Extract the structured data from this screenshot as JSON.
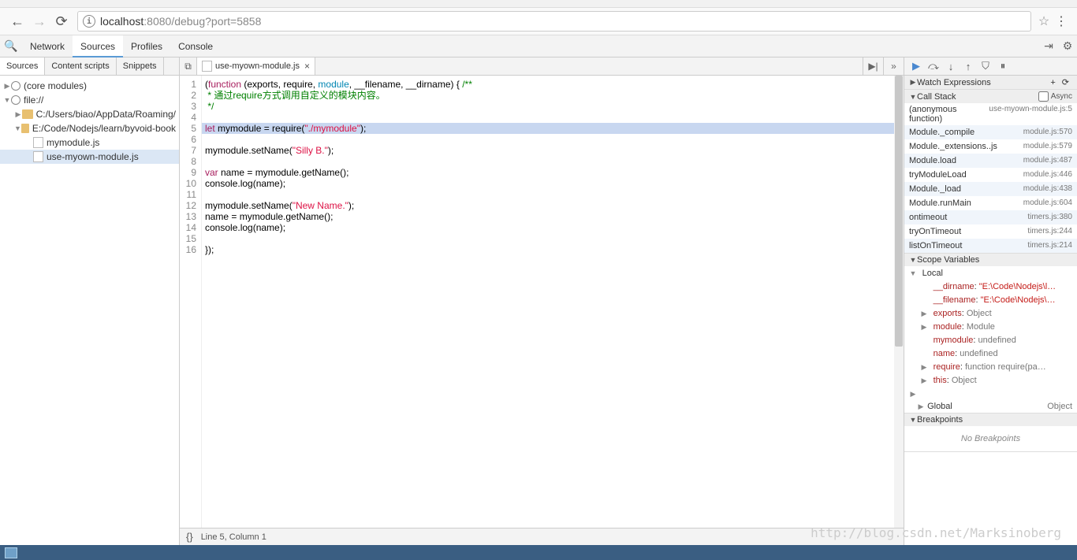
{
  "url": {
    "host": "localhost",
    "port": ":8080",
    "path": "/debug?port=5858"
  },
  "devtools_tabs": [
    "Network",
    "Sources",
    "Profiles",
    "Console"
  ],
  "devtools_active": 1,
  "left_tabs": [
    "Sources",
    "Content scripts",
    "Snippets"
  ],
  "left_active": 0,
  "file_tree": {
    "core": "(core modules)",
    "root": "file://",
    "folders": [
      "C:/Users/biao/AppData/Roaming/",
      "E:/Code/Nodejs/learn/byvoid-book"
    ],
    "files": [
      "mymodule.js",
      "use-myown-module.js"
    ]
  },
  "open_file": "use-myown-module.js",
  "status": "Line 5, Column 1",
  "code_lines": [
    {
      "n": 1,
      "segs": [
        [
          "(",
          "ident"
        ],
        [
          "function",
          "kw"
        ],
        [
          " (exports, require, ",
          "ident"
        ],
        [
          "module",
          "mod"
        ],
        [
          ", __filename, __dirname) { ",
          "ident"
        ],
        [
          "/**",
          "cmt"
        ]
      ]
    },
    {
      "n": 2,
      "segs": [
        [
          " * 通过require方式调用自定义的模块内容。",
          "cmt"
        ]
      ]
    },
    {
      "n": 3,
      "segs": [
        [
          " */",
          "cmt"
        ]
      ]
    },
    {
      "n": 4,
      "segs": []
    },
    {
      "n": 5,
      "hl": true,
      "segs": [
        [
          "let",
          "kw"
        ],
        [
          " mymodule = require(",
          "ident"
        ],
        [
          "\"./mymodule\"",
          "str"
        ],
        [
          ");",
          "ident"
        ]
      ]
    },
    {
      "n": 6,
      "segs": []
    },
    {
      "n": 7,
      "segs": [
        [
          "mymodule.setName(",
          "ident"
        ],
        [
          "\"Silly B.\"",
          "str"
        ],
        [
          ");",
          "ident"
        ]
      ]
    },
    {
      "n": 8,
      "segs": []
    },
    {
      "n": 9,
      "segs": [
        [
          "var",
          "kw"
        ],
        [
          " name = mymodule.getName();",
          "ident"
        ]
      ]
    },
    {
      "n": 10,
      "segs": [
        [
          "console.log(name);",
          "ident"
        ]
      ]
    },
    {
      "n": 11,
      "segs": []
    },
    {
      "n": 12,
      "segs": [
        [
          "mymodule.setName(",
          "ident"
        ],
        [
          "\"New Name.\"",
          "str"
        ],
        [
          ");",
          "ident"
        ]
      ]
    },
    {
      "n": 13,
      "segs": [
        [
          "name = mymodule.getName();",
          "ident"
        ]
      ]
    },
    {
      "n": 14,
      "segs": [
        [
          "console.log(name);",
          "ident"
        ]
      ]
    },
    {
      "n": 15,
      "segs": []
    },
    {
      "n": 16,
      "segs": [
        [
          "});",
          "ident"
        ]
      ]
    }
  ],
  "panels": {
    "watch": "Watch Expressions",
    "callstack": "Call Stack",
    "async": "Async",
    "scope": "Scope Variables",
    "breakpoints": "Breakpoints",
    "nobp": "No Breakpoints"
  },
  "call_stack": {
    "anon_fn": "(anonymous function)",
    "anon_loc": "use-myown-module.js:5",
    "frames": [
      {
        "fn": "Module._compile",
        "loc": "module.js:570"
      },
      {
        "fn": "Module._extensions..js",
        "loc": "module.js:579"
      },
      {
        "fn": "Module.load",
        "loc": "module.js:487"
      },
      {
        "fn": "tryModuleLoad",
        "loc": "module.js:446"
      },
      {
        "fn": "Module._load",
        "loc": "module.js:438"
      },
      {
        "fn": "Module.runMain",
        "loc": "module.js:604"
      },
      {
        "fn": "ontimeout",
        "loc": "timers.js:380"
      },
      {
        "fn": "tryOnTimeout",
        "loc": "timers.js:244"
      },
      {
        "fn": "listOnTimeout",
        "loc": "timers.js:214"
      }
    ]
  },
  "scope": {
    "local": "Local",
    "vars": [
      {
        "tw": "",
        "name": "__dirname",
        "sep": ": ",
        "val": "\"E:\\Code\\Nodejs\\l…",
        "cls": "strv"
      },
      {
        "tw": "",
        "name": "__filename",
        "sep": ": ",
        "val": "\"E:\\Code\\Nodejs\\…",
        "cls": "strv"
      },
      {
        "tw": "▶",
        "name": "exports",
        "sep": ": ",
        "val": "Object",
        "cls": "val"
      },
      {
        "tw": "▶",
        "name": "module",
        "sep": ": ",
        "val": "Module",
        "cls": "val"
      },
      {
        "tw": "",
        "name": "mymodule",
        "sep": ": ",
        "val": "undefined",
        "cls": "val"
      },
      {
        "tw": "",
        "name": "name",
        "sep": ": ",
        "val": "undefined",
        "cls": "val"
      },
      {
        "tw": "▶",
        "name": "require",
        "sep": ": ",
        "val": "function require(pa…",
        "cls": "val"
      },
      {
        "tw": "▶",
        "name": "this",
        "sep": ": ",
        "val": "Object",
        "cls": "val"
      }
    ],
    "global": "Global",
    "global_val": "Object"
  },
  "watermark": "http://blog.csdn.net/Marksinoberg"
}
